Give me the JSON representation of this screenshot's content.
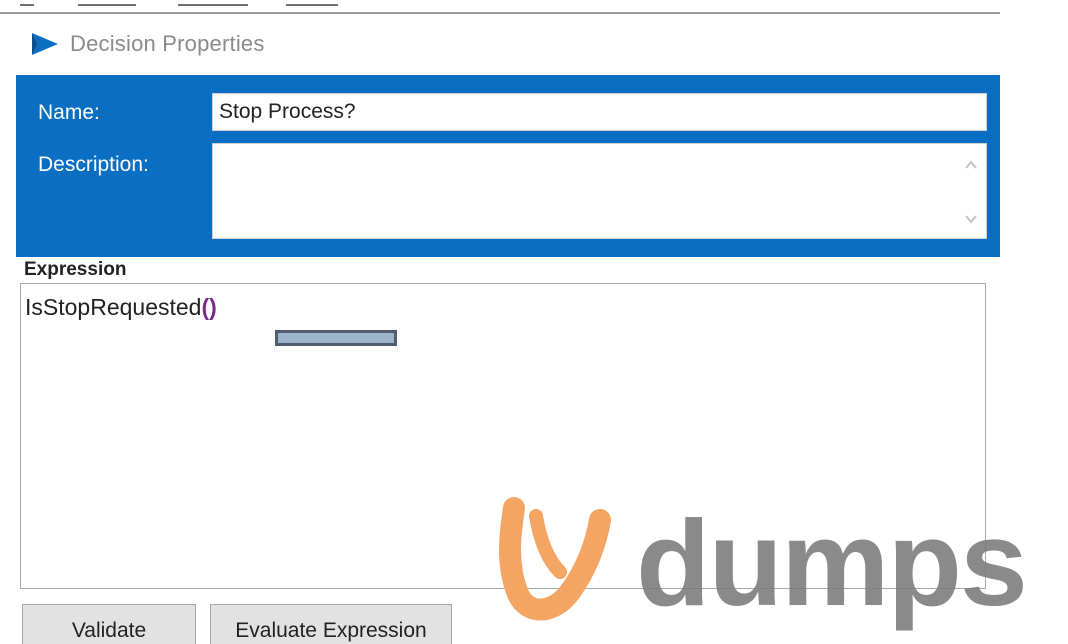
{
  "window": {
    "title": "Decision Properties",
    "icon": "blueprism-logo-icon"
  },
  "properties": {
    "name_label": "Name:",
    "name_value": "Stop Process?",
    "description_label": "Description:",
    "description_value": ""
  },
  "expression": {
    "label": "Expression",
    "function_name": "IsStopRequested",
    "parens": "()"
  },
  "buttons": {
    "validate": "Validate",
    "evaluate": "Evaluate Expression"
  },
  "watermark": {
    "text": "dumps"
  },
  "colors": {
    "panel_blue": "#0a6fc2",
    "paren_purple": "#7a2a8a",
    "watermark_orange": "#f4a463",
    "watermark_gray": "#7b7b7b"
  }
}
